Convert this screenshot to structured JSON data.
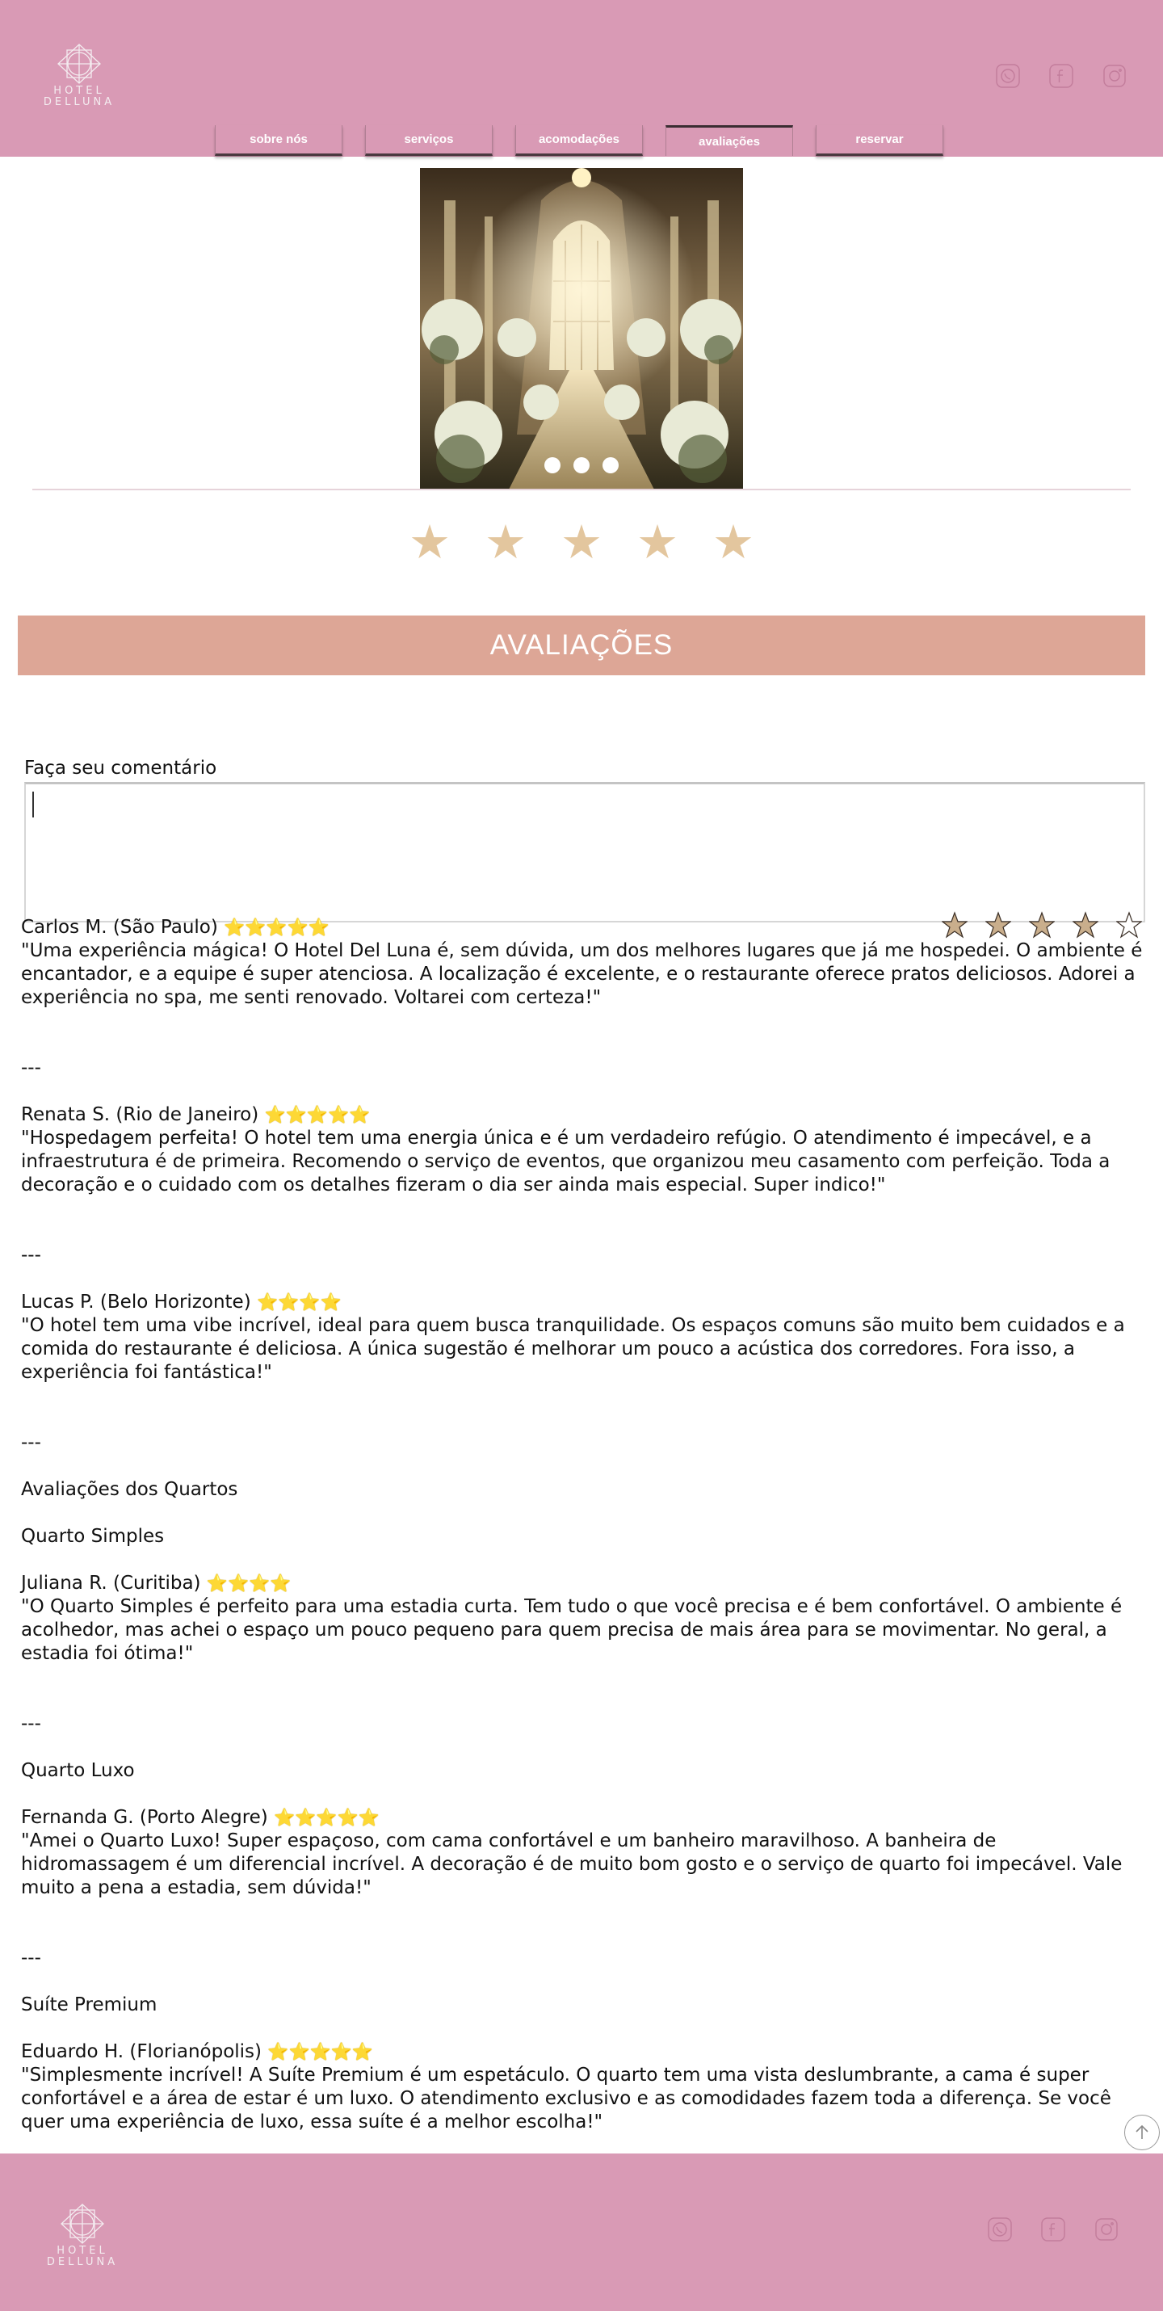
{
  "brand": {
    "line1": "HOTEL",
    "line2": "DELLUNA"
  },
  "colors": {
    "header": "#d99ab5",
    "title_bar": "#dda696",
    "star_gold": "#e3c69e",
    "inline_star": "#f2c61f"
  },
  "social": {
    "icons": [
      "whatsapp-icon",
      "facebook-icon",
      "instagram-icon"
    ]
  },
  "nav": {
    "items": [
      {
        "label": "sobre nós"
      },
      {
        "label": "serviços"
      },
      {
        "label": "acomodações"
      },
      {
        "label": "avaliações",
        "active": true
      },
      {
        "label": "reservar"
      }
    ]
  },
  "hero": {
    "slides": 3,
    "active_slide": 1
  },
  "rating_display": {
    "stars": 5
  },
  "page_title": "AVALIAÇÕES",
  "comment": {
    "label": "Faça seu comentário",
    "value": "",
    "rating_stars": 5
  },
  "reviews": {
    "r1": {
      "author": "Carlos M. (São Paulo)",
      "stars": "⭐⭐⭐⭐⭐",
      "text": "\"Uma experiência mágica! O Hotel Del Luna é, sem dúvida, um dos melhores lugares que já me hospedei. O ambiente é encantador, e a equipe é super atenciosa. A localização é excelente, e o restaurante oferece pratos deliciosos. Adorei a experiência no spa, me senti renovado. Voltarei com certeza!\""
    },
    "sep": "---",
    "r2": {
      "author": "Renata S. (Rio de Janeiro)",
      "stars": "⭐⭐⭐⭐⭐",
      "text": "\"Hospedagem perfeita! O hotel tem uma energia única e é um verdadeiro refúgio. O atendimento é impecável, e a infraestrutura é de primeira. Recomendo o serviço de eventos, que organizou meu casamento com perfeição. Toda a decoração e o cuidado com os detalhes fizeram o dia ser ainda mais especial. Super indico!\""
    },
    "r3": {
      "author": "Lucas P. (Belo Horizonte)",
      "stars": "⭐⭐⭐⭐",
      "text": "\"O hotel tem uma vibe incrível, ideal para quem busca tranquilidade. Os espaços comuns são muito bem cuidados e a comida do restaurante é deliciosa. A única sugestão é melhorar um pouco a acústica dos corredores. Fora isso, a experiência foi fantástica!\""
    },
    "rooms_heading": "Avaliações dos Quartos",
    "room1": "Quarto Simples",
    "r4": {
      "author": "Juliana R. (Curitiba)",
      "stars": "⭐⭐⭐⭐",
      "text": "\"O Quarto Simples é perfeito para uma estadia curta. Tem tudo o que você precisa e é bem confortável. O ambiente é acolhedor, mas achei o espaço um pouco pequeno para quem precisa de mais área para se movimentar. No geral, a estadia foi ótima!\""
    },
    "room2": "Quarto Luxo",
    "r5": {
      "author": "Fernanda G. (Porto Alegre)",
      "stars": "⭐⭐⭐⭐⭐",
      "text": "\"Amei o Quarto Luxo! Super espaçoso, com cama confortável e um banheiro maravilhoso. A banheira de hidromassagem é um diferencial incrível. A decoração é de muito bom gosto e o serviço de quarto foi impecável. Vale muito a pena a estadia, sem dúvida!\""
    },
    "room3": "Suíte Premium",
    "r6": {
      "author": "Eduardo H. (Florianópolis)",
      "stars": "⭐⭐⭐⭐⭐",
      "text": "\"Simplesmente incrível! A Suíte Premium é um espetáculo. O quarto tem uma vista deslumbrante, a cama é super confortável e a área de estar é um luxo. O atendimento exclusivo e as comodidades fazem toda a diferença. Se você quer uma experiência de luxo, essa suíte é a melhor escolha!\""
    }
  }
}
